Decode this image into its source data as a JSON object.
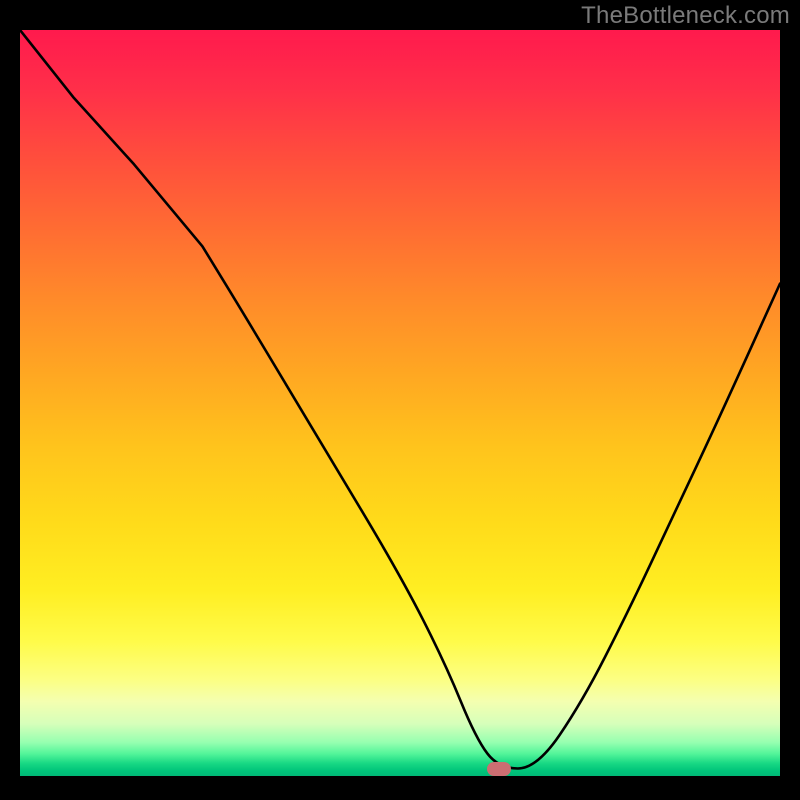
{
  "watermark_text": "TheBottleneck.com",
  "colors": {
    "background": "#000000",
    "watermark": "#7a7a7a",
    "curve": "#000000",
    "marker": "#cc6e72",
    "gradient_top": "#ff1a4d",
    "gradient_bottom": "#00b877"
  },
  "marker": {
    "x_pct": 63,
    "y_pct": 99
  },
  "chart_data": {
    "type": "line",
    "title": "",
    "xlabel": "",
    "ylabel": "",
    "xlim": [
      0,
      100
    ],
    "ylim": [
      0,
      100
    ],
    "legend": false,
    "grid": false,
    "annotations": [
      "TheBottleneck.com"
    ],
    "background_gradient": "red-yellow-green vertical",
    "marker": {
      "x": 63,
      "y": 1,
      "shape": "rounded-rect",
      "color": "#cc6e72"
    },
    "series": [
      {
        "name": "bottleneck-curve",
        "x": [
          0,
          7,
          15,
          24,
          30,
          40,
          50,
          56,
          60,
          63,
          68,
          74,
          80,
          86,
          92,
          100
        ],
        "y": [
          100,
          91,
          82,
          71,
          61,
          44,
          27,
          15,
          5,
          1,
          1,
          10,
          22,
          35,
          48,
          66
        ]
      }
    ],
    "notes": "Axes unlabeled in source image; values are percentages of plot width/height. y=0 is plot bottom (green), y=100 is plot top (red). Curve has a kink near x≈24 and a flat minimum around x≈60–68."
  }
}
